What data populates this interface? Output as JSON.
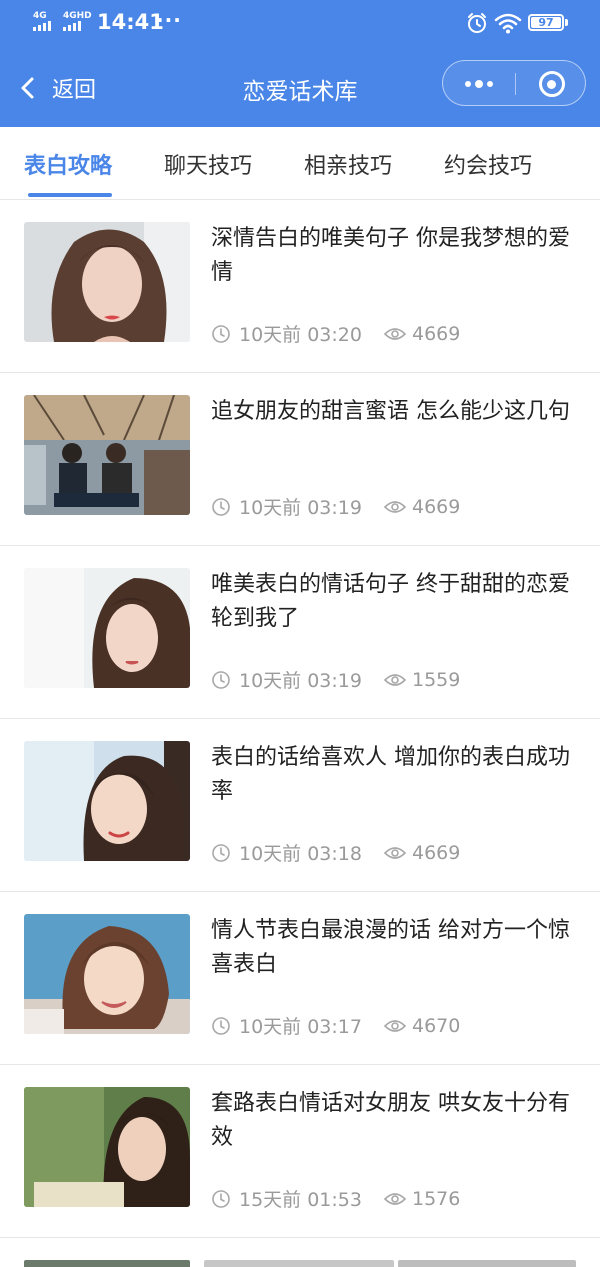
{
  "status_bar": {
    "signal_1": "4G",
    "signal_2": "4GHD",
    "time": "14:41",
    "more": "···",
    "battery": "97"
  },
  "nav": {
    "back_label": "返回",
    "title": "恋爱话术库"
  },
  "tabs": [
    {
      "label": "表白攻略",
      "active": true
    },
    {
      "label": "聊天技巧",
      "active": false
    },
    {
      "label": "相亲技巧",
      "active": false
    },
    {
      "label": "约会技巧",
      "active": false
    }
  ],
  "articles": [
    {
      "title": "深情告白的唯美句子 你是我梦想的爱情",
      "time": "10天前 03:20",
      "views": "4669"
    },
    {
      "title": "追女朋友的甜言蜜语 怎么能少这几句",
      "time": "10天前 03:19",
      "views": "4669"
    },
    {
      "title": "唯美表白的情话句子 终于甜甜的恋爱轮到我了",
      "time": "10天前 03:19",
      "views": "1559"
    },
    {
      "title": "表白的话给喜欢人 增加你的表白成功率",
      "time": "10天前 03:18",
      "views": "4669"
    },
    {
      "title": "情人节表白最浪漫的话 给对方一个惊喜表白",
      "time": "10天前 03:17",
      "views": "4670"
    },
    {
      "title": "套路表白情话对女朋友 哄女友十分有效",
      "time": "15天前 01:53",
      "views": "1576"
    }
  ],
  "colors": {
    "brand": "#4a86e8",
    "text": "#222222",
    "meta": "#9a9a9a",
    "divider": "#e6e6e6"
  }
}
